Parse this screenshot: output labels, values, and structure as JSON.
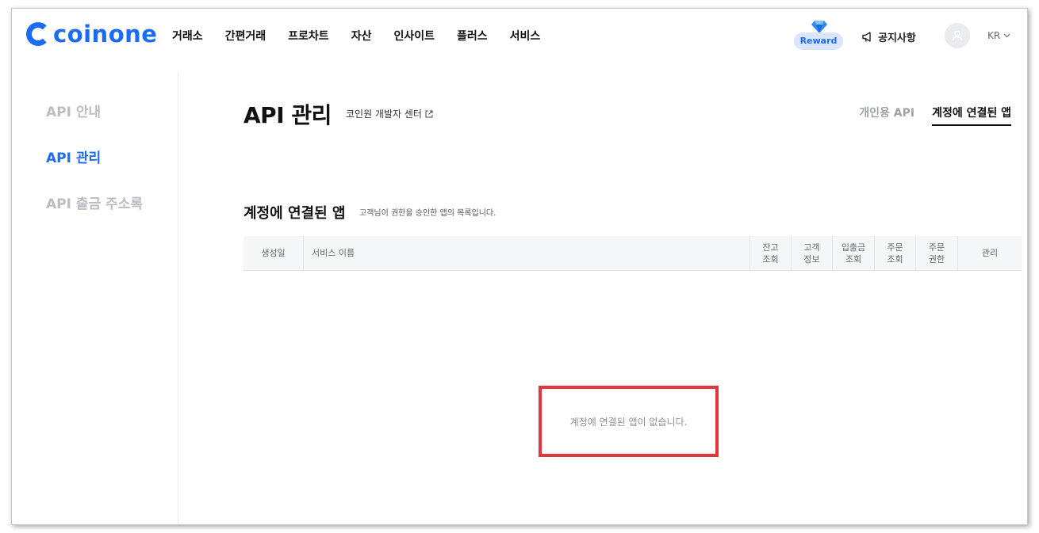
{
  "header": {
    "logo_text": "coinone",
    "nav": [
      "거래소",
      "간편거래",
      "프로차트",
      "자산",
      "인사이트",
      "플러스",
      "서비스"
    ],
    "reward_label": "Reward",
    "notice_label": "공지사항",
    "lang_label": "KR"
  },
  "sidebar": {
    "items": [
      {
        "label": "API 안내",
        "active": false
      },
      {
        "label": "API 관리",
        "active": true
      },
      {
        "label": "API 출금 주소록",
        "active": false
      }
    ]
  },
  "main": {
    "title": "API 관리",
    "dev_center_link": "코인원 개발자 센터",
    "tabs": [
      {
        "label": "개인용 API",
        "active": false
      },
      {
        "label": "계정에 연결된 앱",
        "active": true
      }
    ],
    "section_title": "계정에 연결된 앱",
    "section_desc": "고객님이 권한을 승인한 앱의 목록입니다.",
    "table_headers": [
      "생성일",
      "서비스 이름",
      "잔고\n조회",
      "고객\n정보",
      "입출금\n조회",
      "주문\n조회",
      "주문\n권한",
      "관리"
    ],
    "empty_message": "계정에 연결된 앱이 없습니다."
  },
  "colors": {
    "brand": "#1c6bf5",
    "highlight_box": "#e5353c"
  }
}
